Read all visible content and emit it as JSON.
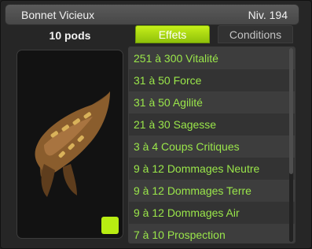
{
  "window": {
    "title": "Bonnet Vicieux",
    "level": "Niv. 194"
  },
  "item": {
    "weight": "10 pods"
  },
  "tabs": [
    {
      "label": "Effets",
      "active": true
    },
    {
      "label": "Conditions",
      "active": false
    }
  ],
  "effects": [
    "251 à 300 Vitalité",
    "31 à 50 Force",
    "31 à 50 Agilité",
    "21 à 30 Sagesse",
    "3 à 4 Coups Critiques",
    "9 à 12 Dommages Neutre",
    "9 à 12 Dommages Terre",
    "9 à 12 Dommages Air",
    "7 à 10 Prospection"
  ],
  "colors": {
    "effect_text": "#9ae64a",
    "active_tab": "#a9d813",
    "recipe_button": "#b8ec12"
  },
  "icons": {
    "recipe": "recipe-pot-icon",
    "item": "hat-icon"
  }
}
